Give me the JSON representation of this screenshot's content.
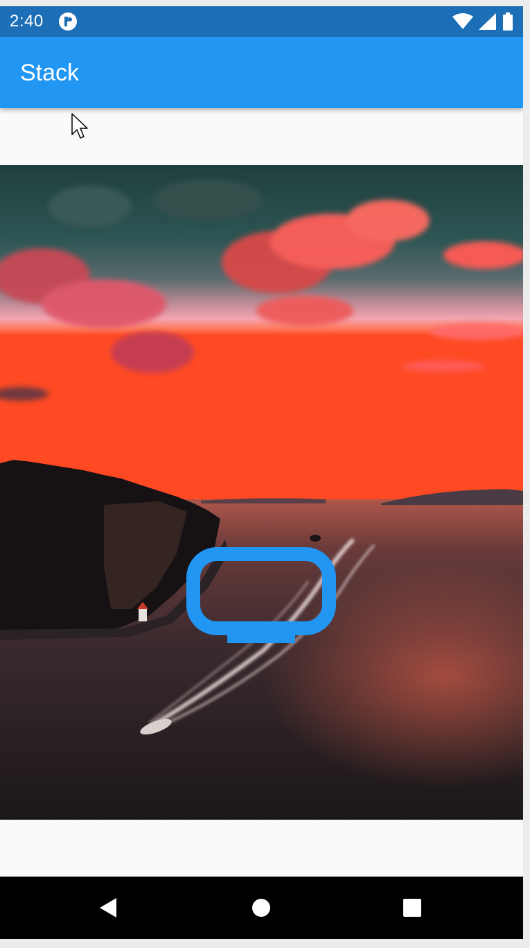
{
  "status_bar": {
    "time": "2:40",
    "icons": [
      "notification-app-icon",
      "wifi-icon",
      "cellular-signal-icon",
      "battery-icon"
    ]
  },
  "app_bar": {
    "title": "Stack",
    "color": "#2196F3"
  },
  "content": {
    "image": "sunset-seascape-with-speedboat",
    "overlay_icon": "tv-icon",
    "overlay_icon_color": "#2196F3"
  },
  "nav_bar": {
    "buttons": [
      "back-icon",
      "home-icon",
      "recents-icon"
    ]
  }
}
